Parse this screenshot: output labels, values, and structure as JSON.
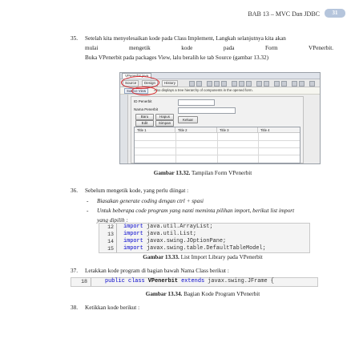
{
  "header": {
    "title": "BAB 13 – MVC Dan JDBC",
    "page_number": "31"
  },
  "item35": {
    "number": "35.",
    "line1": "Setelah kita menyelesaikan kode pada Class Implement, Langkah selanjutnya kita akan",
    "line2": "mulai mengetik kode pada Form VPenerbit.",
    "line3": "Buka VPenerbit pada packages View, lalu beralih ke tab Source (gambar 13.32)"
  },
  "screenshot": {
    "file_tab": "VPenerbit.java",
    "view_buttons": [
      "Source",
      "Design",
      "History"
    ],
    "hint_button": "Source View",
    "hint_text": "Also displays a tree hierarchy of components in the opened form.",
    "labels": [
      "ID Penerbit",
      "Nama Penerbit"
    ],
    "buttons": [
      "Baru",
      "Hapus",
      "Edit",
      "Simpan",
      "Keluar"
    ],
    "table_headers": [
      "Title 1",
      "Title 2",
      "Title 3",
      "Title 4"
    ]
  },
  "fig1": {
    "label": "Gambar 13.32.",
    "text": " Tampilan Form VPenerbit"
  },
  "item36": {
    "number": "36.",
    "text": "Sebelum mengetik kode, yang perlu diingat :",
    "bullet1": "Biasakan generate coding dengan ctrl + spasi",
    "bullet2_line1": "Untuk beberapa code program yang nanti meminta pilihan import, berikut list import",
    "bullet2_line2": "yang dipilih :"
  },
  "imports": [
    {
      "ln": "12",
      "kw": "import",
      "rest": " java.util.ArrayList;"
    },
    {
      "ln": "13",
      "kw": "import",
      "rest": " java.util.List;"
    },
    {
      "ln": "14",
      "kw": "import",
      "rest": " javax.swing.JOptionPane;"
    },
    {
      "ln": "15",
      "kw": "import",
      "rest": " javax.swing.table.DefaultTableModel;"
    }
  ],
  "fig2": {
    "label": "Gambar 13.33.",
    "text": " List Import Library pada VPenerbit"
  },
  "item37": {
    "number": "37.",
    "text": "Letakkan kode program di bagian bawah Nama Class berikut :"
  },
  "classline": {
    "ln": "18",
    "kw1": "public",
    "kw2": "class",
    "name": "VPenerbit",
    "kw3": "extends",
    "rest": " javax.swing.JFrame {"
  },
  "fig3": {
    "label": "Gambar 13.34.",
    "text": " Bagian Kode Program VPenerbit"
  },
  "item38": {
    "number": "38.",
    "text": "Ketikkan kode berikut :"
  }
}
